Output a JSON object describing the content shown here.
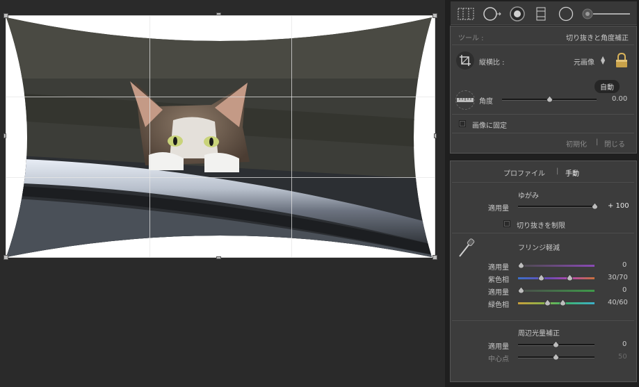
{
  "crop_tool": {
    "tool_label": "ツール :",
    "tool_name": "切り抜きと角度補正",
    "aspect_label": "縦横比 :",
    "aspect_value": "元画像",
    "auto_button": "自動",
    "angle_label": "角度",
    "angle_value": "0.00",
    "angle_level": 0.5,
    "lock_label": "画像に固定",
    "reset_button": "初期化",
    "divider": "|",
    "close_button": "閉じる"
  },
  "lens_panel": {
    "tabs": [
      "プロファイル",
      "手動"
    ],
    "tab_divider": "|",
    "distortion": {
      "title": "ゆがみ",
      "amount_label": "適用量",
      "amount_value": "+ 100",
      "amount_level": 1.0,
      "constrain_label": "切り抜きを制限"
    },
    "fringe": {
      "title": "フリンジ軽減",
      "rows": [
        {
          "label": "適用量",
          "value": "0"
        },
        {
          "label": "紫色相",
          "value": "30/70"
        },
        {
          "label": "適用量",
          "value": "0"
        },
        {
          "label": "緑色相",
          "value": "40/60"
        }
      ]
    },
    "vignette": {
      "title": "周辺光量補正",
      "rows": [
        {
          "label": "適用量",
          "value": "0"
        },
        {
          "label": "中心点",
          "value": "50"
        }
      ]
    }
  },
  "colors": {
    "accent_lock": "#c9a24a",
    "purple_track": "#8a4ab5",
    "green_track": "#3f9a4a"
  }
}
